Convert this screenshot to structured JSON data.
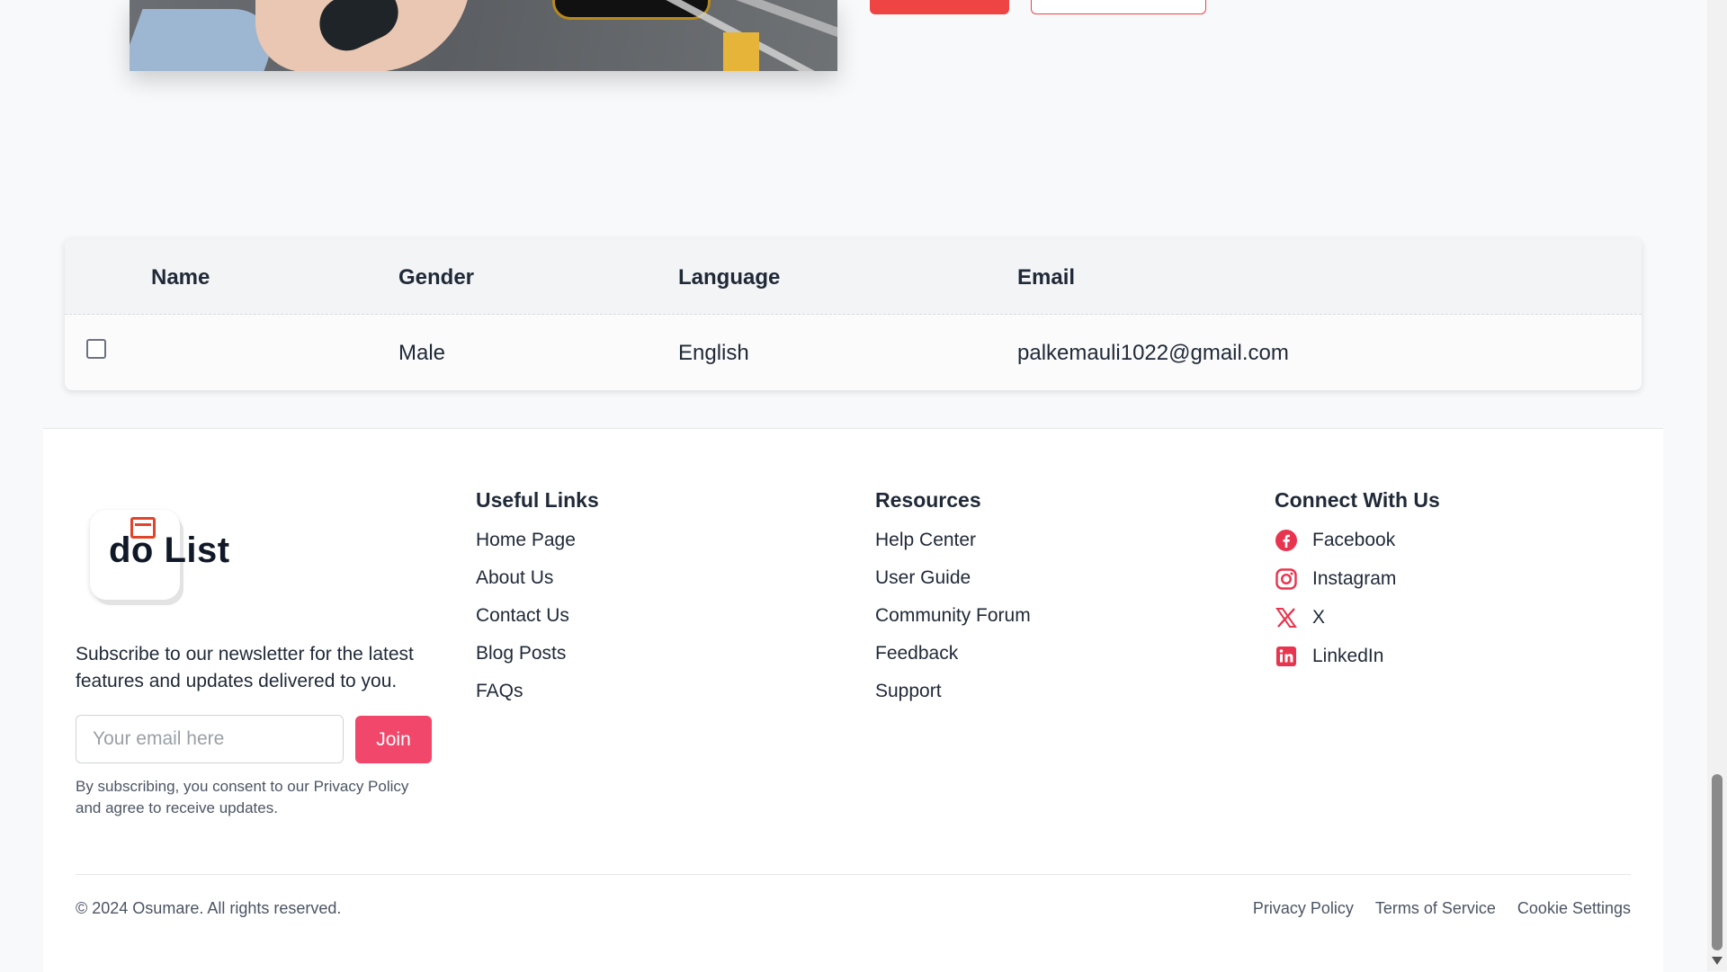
{
  "table": {
    "headers": {
      "name": "Name",
      "gender": "Gender",
      "language": "Language",
      "email": "Email"
    },
    "rows": [
      {
        "name": "",
        "gender": "Male",
        "language": "English",
        "email": "palkemauli1022@gmail.com"
      }
    ]
  },
  "footer": {
    "logo_text": "do List",
    "newsletter_text": "Subscribe to our newsletter for the latest features and updates delivered to you.",
    "email_placeholder": "Your email here",
    "join_label": "Join",
    "consent_text": "By subscribing, you consent to our Privacy Policy and agree to receive updates.",
    "useful_links": {
      "title": "Useful Links",
      "items": [
        "Home Page",
        "About Us",
        "Contact Us",
        "Blog Posts",
        "FAQs"
      ]
    },
    "resources": {
      "title": "Resources",
      "items": [
        "Help Center",
        "User Guide",
        "Community Forum",
        "Feedback",
        "Support"
      ]
    },
    "connect": {
      "title": "Connect With Us",
      "items": [
        {
          "label": "Facebook",
          "icon": "facebook-icon"
        },
        {
          "label": "Instagram",
          "icon": "instagram-icon"
        },
        {
          "label": "X",
          "icon": "x-icon"
        },
        {
          "label": "LinkedIn",
          "icon": "linkedin-icon"
        }
      ]
    },
    "copyright": "© 2024 Osumare. All rights reserved.",
    "legal_links": [
      "Privacy Policy",
      "Terms of Service",
      "Cookie Settings"
    ]
  },
  "colors": {
    "accent": "#f0476a",
    "primary_button": "#ef4444",
    "social_icon": "#e8354f"
  }
}
